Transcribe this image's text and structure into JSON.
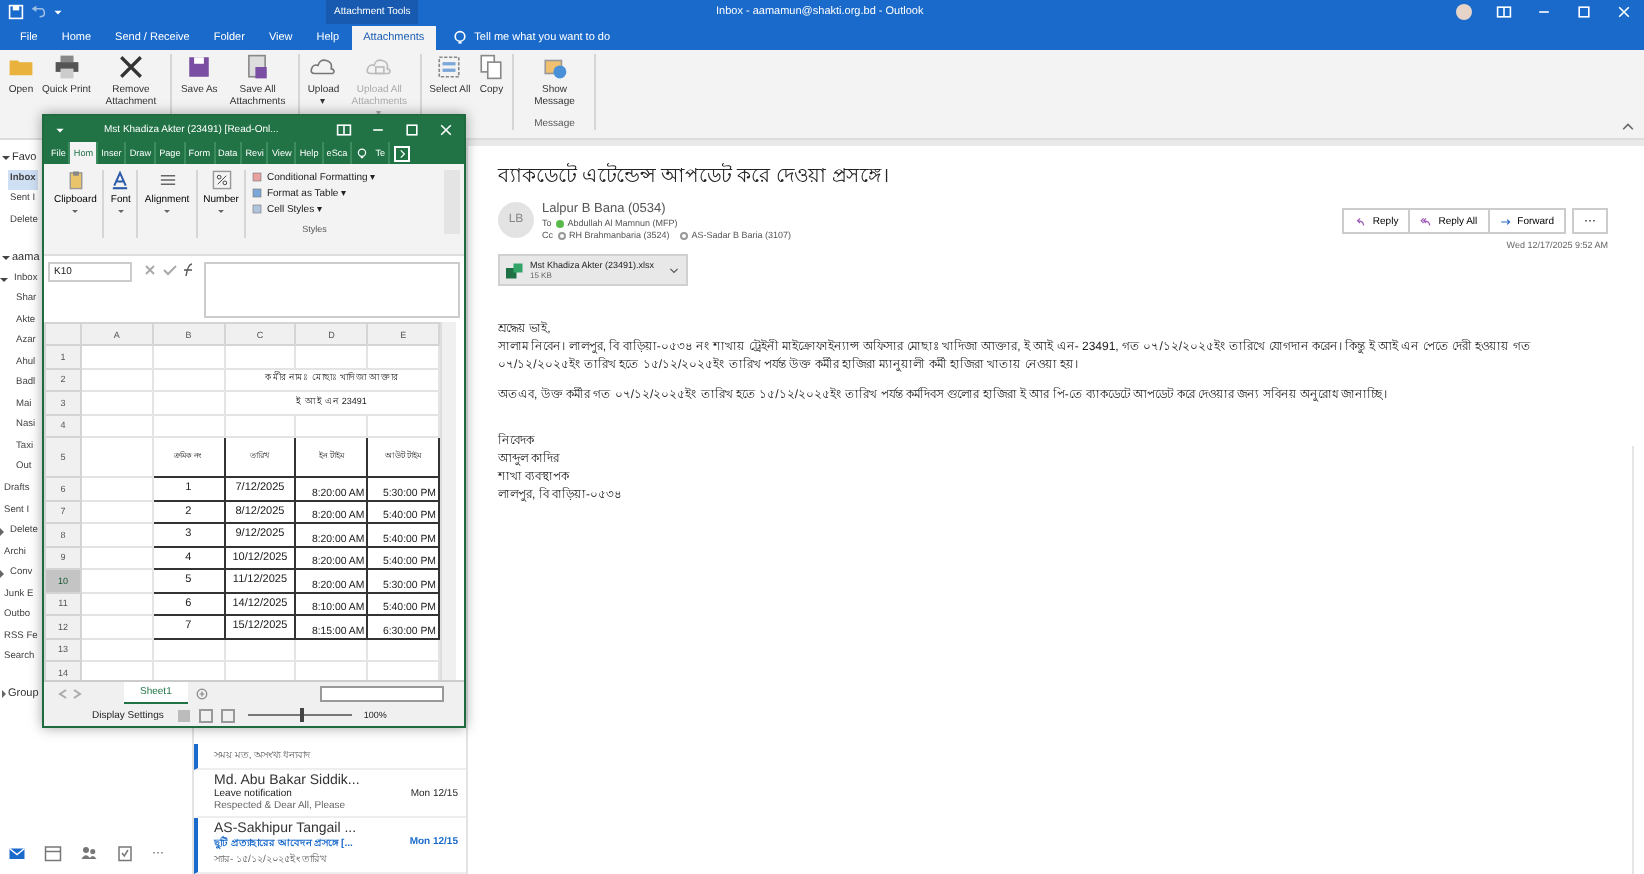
{
  "outlook_window": {
    "title": "Inbox - aamamun@shakti.org.bd - Outlook",
    "context_title": "Attachment Tools"
  },
  "menu_tabs": [
    {
      "label": "File",
      "selected": false
    },
    {
      "label": "Home",
      "selected": false
    },
    {
      "label": "Send / Receive",
      "selected": false
    },
    {
      "label": "Folder",
      "selected": false
    },
    {
      "label": "View",
      "selected": false
    },
    {
      "label": "Help",
      "selected": false
    },
    {
      "label": "Attachments",
      "selected": true
    }
  ],
  "tell_me": {
    "placeholder": "Tell me what you want to do"
  },
  "ribbon": {
    "buttons": [
      {
        "label": "Open",
        "disabled": false
      },
      {
        "label": "Quick Print",
        "disabled": false
      },
      {
        "label": "Remove Attachment",
        "disabled": false
      },
      {
        "label": "Save As",
        "disabled": false
      },
      {
        "label": "Save All Attachments",
        "disabled": false
      },
      {
        "label": "Upload",
        "disabled": false,
        "dropdown": "▾"
      },
      {
        "label": "Upload All Attachments",
        "disabled": true,
        "dropdown": "▾"
      },
      {
        "label": "Select All",
        "disabled": false
      },
      {
        "label": "Copy",
        "disabled": false
      },
      {
        "label": "Show Message",
        "disabled": false
      }
    ],
    "group_label": "Message"
  },
  "folder_pane": {
    "favorites": {
      "label": "Favo",
      "expanded": true,
      "items": [
        {
          "label": "Inbox",
          "selected": true
        },
        {
          "label": "Sent I",
          "selected": false
        },
        {
          "label": "Delete",
          "selected": false
        }
      ]
    },
    "account": {
      "label": "aama",
      "expanded": true,
      "folders": [
        {
          "label": "Inbox",
          "selected": false,
          "expanded": true,
          "children": [
            {
              "label": "Shar",
              "selected": false
            },
            {
              "label": "Akte",
              "selected": false
            },
            {
              "label": "Azar",
              "selected": false
            },
            {
              "label": "Ahul",
              "selected": false
            },
            {
              "label": "Badl",
              "selected": false
            },
            {
              "label": "Mai",
              "selected": false
            },
            {
              "label": "Nasi",
              "selected": false
            },
            {
              "label": "Taxi",
              "selected": false
            },
            {
              "label": "Out",
              "selected": false
            }
          ]
        },
        {
          "label": "Drafts",
          "selected": false
        },
        {
          "label": "Sent I",
          "selected": false
        },
        {
          "label": "Delete",
          "selected": false,
          "expanded": false
        },
        {
          "label": "Archi",
          "selected": false
        },
        {
          "label": "Conv",
          "selected": false,
          "expanded": false
        },
        {
          "label": "Junk E",
          "selected": false
        },
        {
          "label": "Outbo",
          "selected": false
        },
        {
          "label": "RSS Fe",
          "selected": false
        },
        {
          "label": "Search",
          "selected": false
        }
      ]
    },
    "groups": {
      "label": "Group",
      "expanded": false
    }
  },
  "bottom_nav": {
    "items": [
      {
        "selected": true
      },
      {
        "selected": false
      },
      {
        "selected": false
      },
      {
        "selected": false
      }
    ],
    "more": "···"
  },
  "messages": [
    {
      "preview": "সময় মত, অসংখ্য ধন্যবাদ",
      "unread": true
    },
    {
      "sender": "Md. Abu Bakar Siddik...",
      "subject": "Leave notification",
      "date": "Mon 12/15",
      "preview": "Respected & Dear All,  Please",
      "unread": false
    },
    {
      "sender": "AS-Sakhipur Tangail ...",
      "subject": "ছুটি প্রত্যাহারের আবেদন প্রসঙ্গে [...",
      "date": "Mon 12/15",
      "preview": "স্যার- ১৫/১২/২০২৫ইং তারিখ",
      "unread": true
    }
  ],
  "message": {
    "subject": "ব্যাকডেটে এটেন্ডেন্স আপডেট করে দেওয়া প্রসঙ্গে।",
    "avatar_initials": "LB",
    "sender": "Lalpur B Bana (0534)",
    "to_label": "To",
    "to": [
      {
        "name": "Abdullah Al Mamnun (MFP)",
        "online": true
      }
    ],
    "cc_label": "Cc",
    "cc": [
      {
        "name": "RH Brahmanbaria (3524)",
        "online": false
      },
      {
        "name": "AS-Sadar B Baria (3107)",
        "online": false
      }
    ],
    "attachment": {
      "name": "Mst Khadiza Akter (23491).xlsx",
      "size": "15 KB"
    },
    "actions": [
      "Reply",
      "Reply All",
      "Forward"
    ],
    "more": "···",
    "date": "Wed 12/17/2025 9:52 AM",
    "greeting": "শ্রদ্ধেয় ভাই,",
    "paragraphs": [
      "সালাম নিবেন। লালপুর, বি বাড়িয়া-০৫৩৪ নং শাখায় ট্রেইনী মাইক্রোফাইন্যান্স অফিসার মোছাঃ খাদিজা আক্তার, ই আই এন- 23491, গত ০৭/১২/২০২৫ইং তারিখে যোগদান করেন। কিন্তু ই আই এন পেতে দেরী হওয়ায় গত ০৭/১২/২০২৫ইং তারিখ হতে ১৫/১২/২০২৫ইং তারিখ পর্যন্ত উক্ত কর্মীর হাজিরা ম্যানুয়ালী কর্মী হাজিরা খাতায় নেওয়া হয়।",
      "অতএব, উক্ত কর্মীর গত ০৭/১২/২০২৫ইং তারিখ হতে ১৫/১২/২০২৫ইং তারিখ পর্যন্ত কর্মদিবস গুলোর হাজিরা ই আর পি-তে ব্যাকডেটে আপডেট করে দেওয়ার জন্য সবিনয় অনুরোধ জানাচ্ছি।"
    ],
    "signature": [
      "নিবেদক",
      "আব্দুল কাদির",
      "শাখা ব্যবস্থাপক",
      "লালপুর, বি বাড়িয়া-০৫৩৪"
    ]
  },
  "excel_window": {
    "title": "Mst Khadiza Akter (23491)  [Read-Onl...",
    "tabs": [
      {
        "label": "File",
        "selected": false
      },
      {
        "label": "Hom",
        "selected": true
      },
      {
        "label": "Inser",
        "selected": false
      },
      {
        "label": "Draw",
        "selected": false
      },
      {
        "label": "Page",
        "selected": false
      },
      {
        "label": "Form",
        "selected": false
      },
      {
        "label": "Data",
        "selected": false
      },
      {
        "label": "Revi",
        "selected": false
      },
      {
        "label": "View",
        "selected": false
      },
      {
        "label": "Help",
        "selected": false
      },
      {
        "label": "eSca",
        "selected": false
      }
    ],
    "tell_me": "Te",
    "ribbon_groups": [
      "Clipboard",
      "Font",
      "Alignment",
      "Number"
    ],
    "styles_items": [
      "Conditional Formatting ▾",
      "Format as Table ▾",
      "Cell Styles ▾"
    ],
    "styles_label": "Styles",
    "name_box": "K10",
    "columns": [
      "A",
      "B",
      "C",
      "D",
      "E"
    ],
    "rows": [
      {
        "label": "1",
        "selected": false
      },
      {
        "label": "2",
        "selected": false
      },
      {
        "label": "3",
        "selected": false
      },
      {
        "label": "4",
        "selected": false
      },
      {
        "label": "5",
        "selected": false
      },
      {
        "label": "6",
        "selected": false
      },
      {
        "label": "7",
        "selected": false
      },
      {
        "label": "8",
        "selected": false
      },
      {
        "label": "9",
        "selected": false
      },
      {
        "label": "10",
        "selected": true
      },
      {
        "label": "11",
        "selected": false
      },
      {
        "label": "12",
        "selected": false
      },
      {
        "label": "13",
        "selected": false
      },
      {
        "label": "14",
        "selected": false
      }
    ],
    "title_lines": [
      "কর্মীর নামঃ মোছাঃ খাদিজা আক্তার",
      "ই আই এন 23491"
    ],
    "header": [
      "ক্রমিক নং",
      "তারিখ",
      "ইন টাইম",
      "আউট টাইম"
    ],
    "data": [
      [
        "1",
        "7/12/2025",
        "8:20:00 AM",
        "5:30:00 PM"
      ],
      [
        "2",
        "8/12/2025",
        "8:20:00 AM",
        "5:40:00 PM"
      ],
      [
        "3",
        "9/12/2025",
        "8:20:00 AM",
        "5:40:00 PM"
      ],
      [
        "4",
        "10/12/2025",
        "8:20:00 AM",
        "5:40:00 PM"
      ],
      [
        "5",
        "11/12/2025",
        "8:20:00 AM",
        "5:30:00 PM"
      ],
      [
        "6",
        "14/12/2025",
        "8:10:00 AM",
        "5:40:00 PM"
      ],
      [
        "7",
        "15/12/2025",
        "8:15:00 AM",
        "6:30:00 PM"
      ]
    ],
    "sheet_tabs": [
      {
        "label": "Sheet1",
        "selected": true
      }
    ],
    "display_settings": "Display Settings",
    "zoom_slider": {
      "level": 0.5
    },
    "zoom": "100%"
  }
}
